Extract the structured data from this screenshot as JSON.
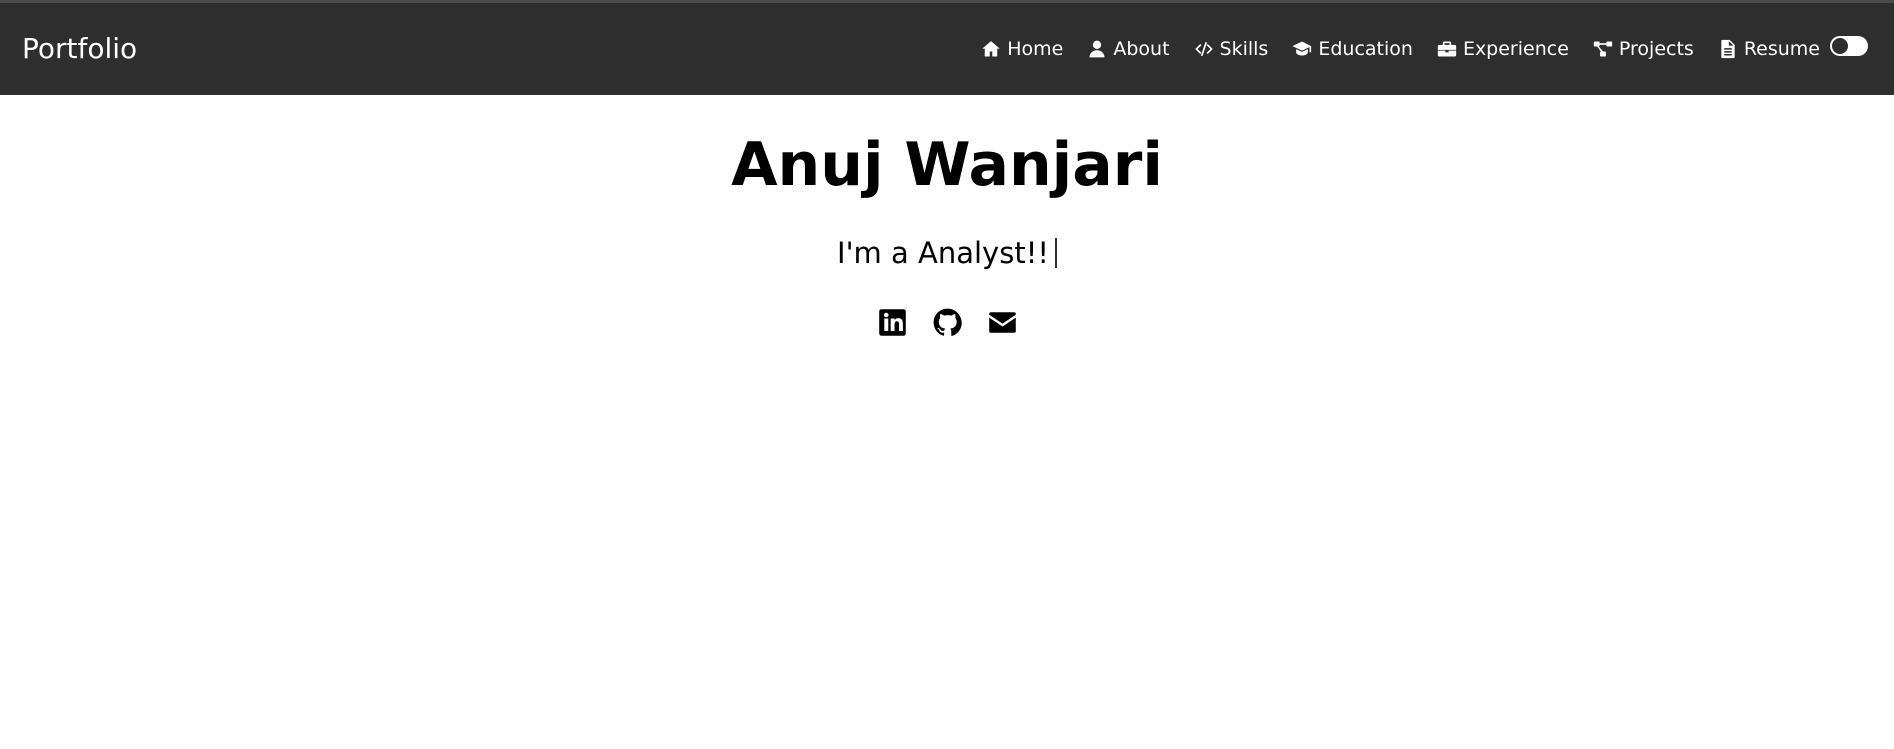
{
  "navbar": {
    "brand": "Portfolio",
    "items": [
      {
        "label": "Home",
        "icon": "home-icon"
      },
      {
        "label": "About",
        "icon": "user-icon"
      },
      {
        "label": "Skills",
        "icon": "code-icon"
      },
      {
        "label": "Education",
        "icon": "graduation-cap-icon"
      },
      {
        "label": "Experience",
        "icon": "briefcase-icon"
      },
      {
        "label": "Projects",
        "icon": "project-diagram-icon"
      },
      {
        "label": "Resume",
        "icon": "file-icon"
      }
    ],
    "theme_toggle": {
      "state": "off"
    }
  },
  "hero": {
    "name": "Anuj Wanjari",
    "role_text": "I'm a Analyst!!"
  },
  "socials": [
    {
      "icon": "linkedin-icon"
    },
    {
      "icon": "github-icon"
    },
    {
      "icon": "envelope-icon"
    }
  ],
  "colors": {
    "navbar_bg": "#2e2e2e",
    "page_bg": "#ffffff",
    "text": "#000000"
  }
}
